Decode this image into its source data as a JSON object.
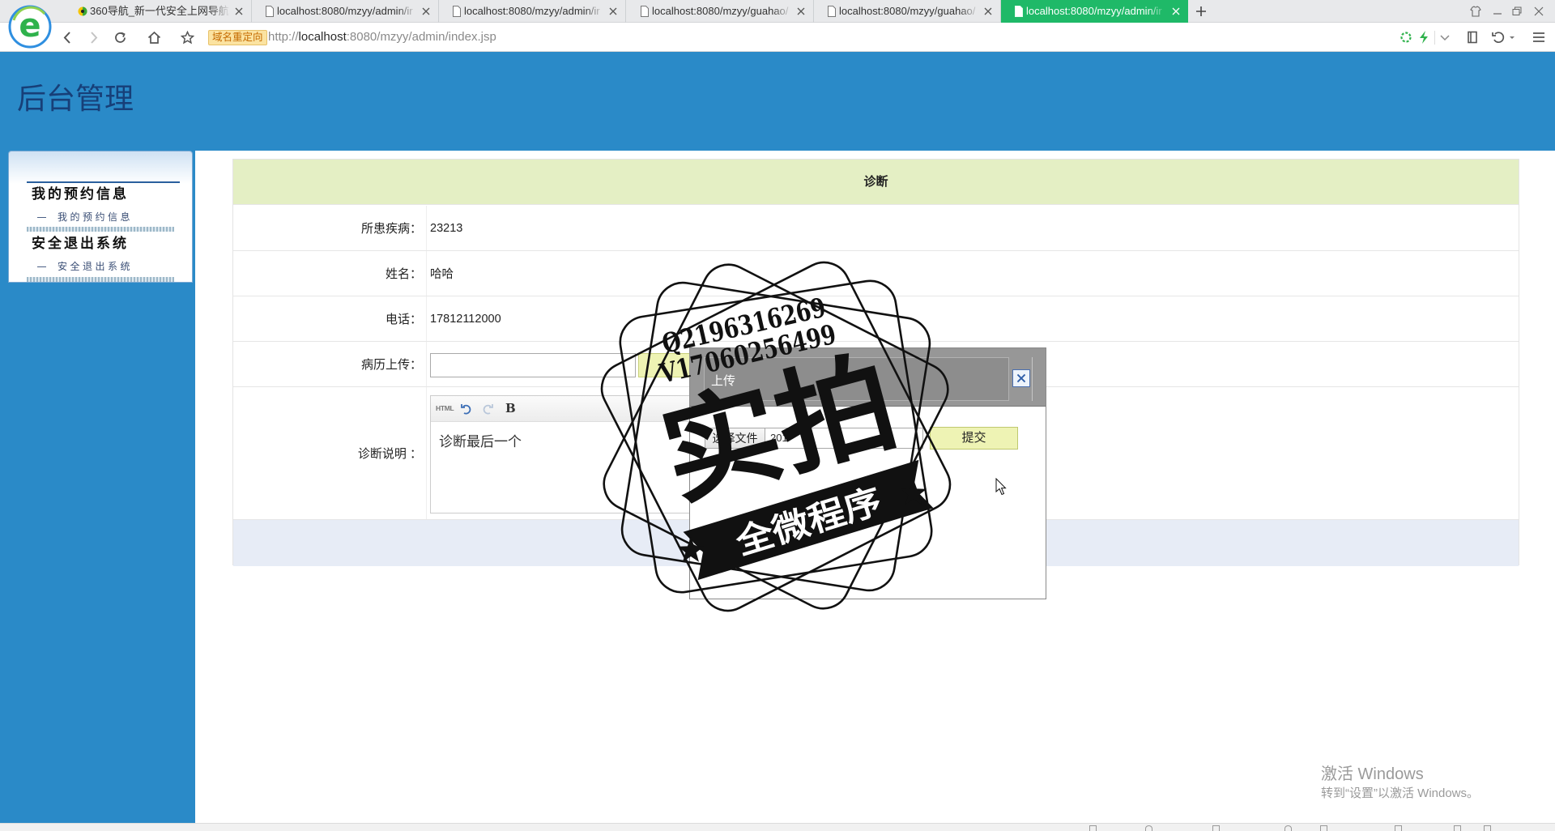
{
  "browser": {
    "logo_letter": "e",
    "tabs": [
      {
        "title": "360导航_新一代安全上网导航",
        "active": false
      },
      {
        "title": "localhost:8080/mzyy/admin/ir",
        "active": false
      },
      {
        "title": "localhost:8080/mzyy/admin/ir",
        "active": false
      },
      {
        "title": "localhost:8080/mzyy/guahao/",
        "active": false
      },
      {
        "title": "localhost:8080/mzyy/guahao/",
        "active": false
      },
      {
        "title": "localhost:8080/mzyy/admin/ir",
        "active": true
      }
    ],
    "redirect_badge": "域名重定向",
    "url": {
      "scheme": "http://",
      "host": "localhost",
      "path": ":8080/mzyy/admin/index.jsp"
    },
    "icons": [
      "back-icon",
      "forward-icon",
      "reload-icon",
      "home-icon",
      "star-icon",
      "speed-icon",
      "lightning-icon",
      "chevron-down-icon",
      "reading-mode-icon",
      "undo-icon",
      "menu-icon"
    ]
  },
  "header": {
    "title": "后台管理"
  },
  "sidebar": {
    "sections": [
      {
        "title": "我的预约信息",
        "items": [
          "我的预约信息"
        ]
      },
      {
        "title": "安全退出系统",
        "items": [
          "安全退出系统"
        ]
      }
    ]
  },
  "form": {
    "heading": "诊断",
    "fields": [
      {
        "label": "所患疾病：",
        "value": "23213"
      },
      {
        "label": "姓名：",
        "value": "哈哈"
      },
      {
        "label": "电话：",
        "value": "17812112000"
      },
      {
        "label": "病历上传："
      },
      {
        "label": "诊断说明 ：",
        "value": "诊断最后一个"
      }
    ]
  },
  "editor": {
    "toolbar": {
      "html_label": "HTML",
      "bold_label": "B"
    }
  },
  "dialog": {
    "title": "上传",
    "choose_file_label": "选择文件",
    "file_name": "201",
    "submit_label": "提交"
  },
  "watermark": {
    "line1": "Q2196316269",
    "line2": "V17060256499",
    "main": "实拍",
    "banner": "全微程序"
  },
  "os_watermark": {
    "line1": "激活 Windows",
    "line2": "转到“设置”以激活 Windows。"
  },
  "theme": {
    "header_bg": "#2a8ac8",
    "title_color": "#173f78",
    "active_tab": "#1fb968",
    "form_head_bg": "#e4efc4",
    "form_foot_bg": "#e7ecf6",
    "dialog_title_bg": "#979797",
    "submit_bg": "#eef3b4"
  }
}
